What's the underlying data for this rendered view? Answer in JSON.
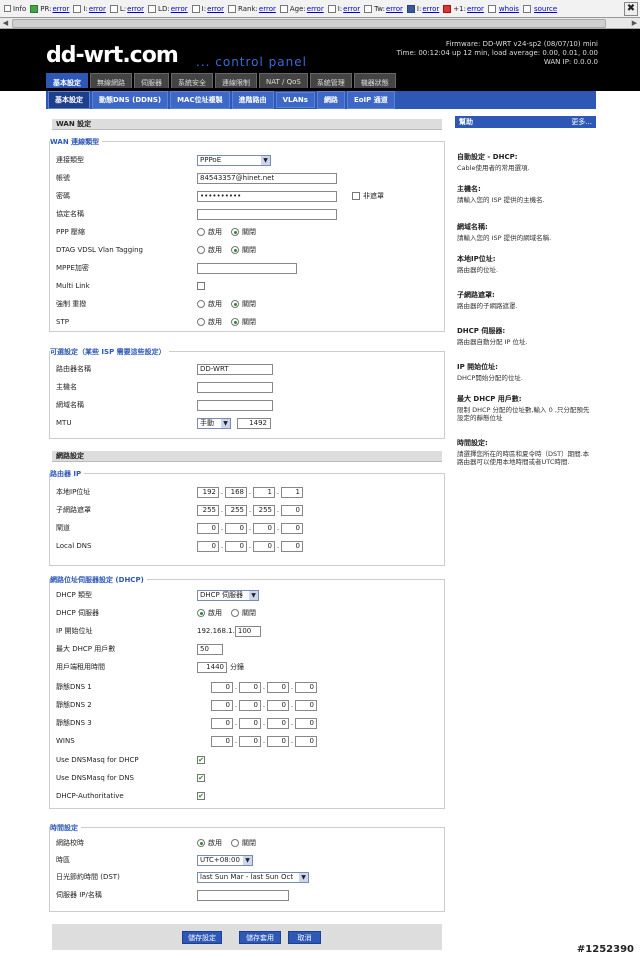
{
  "seobar": {
    "items": [
      {
        "label": "Info",
        "value": "",
        "icon": "info-icon"
      },
      {
        "label": "PR:",
        "value": "error",
        "icon": "google-icon"
      },
      {
        "label": "I:",
        "value": "error",
        "icon": "index-icon"
      },
      {
        "label": "L:",
        "value": "error",
        "icon": "link-icon"
      },
      {
        "label": "LD:",
        "value": "error",
        "icon": "linkdomain-icon"
      },
      {
        "label": "I:",
        "value": "error",
        "icon": "bing-icon"
      },
      {
        "label": "Rank:",
        "value": "error",
        "icon": "rank-icon"
      },
      {
        "label": "Age:",
        "value": "error",
        "icon": "age-icon"
      },
      {
        "label": "I:",
        "value": "error",
        "icon": "yahoo-icon"
      },
      {
        "label": "Tw:",
        "value": "error",
        "icon": "twitter-icon"
      },
      {
        "label": "I:",
        "value": "error",
        "icon": "facebook-icon"
      },
      {
        "label": "+1:",
        "value": "error",
        "icon": "gplus-icon"
      },
      {
        "label": "",
        "value": "whois",
        "icon": "whois-icon"
      },
      {
        "label": "",
        "value": "source",
        "icon": "source-icon"
      }
    ],
    "close": "✖"
  },
  "header": {
    "logo": "dd-wrt.com",
    "subtitle": "... control panel",
    "firmware": "Firmware: DD-WRT v24-sp2 (08/07/10) mini",
    "time": "Time: 00:12:04 up 12 min, load average: 0.00, 0.01, 0.00",
    "wanip": "WAN IP: 0.0.0.0"
  },
  "nav": {
    "main": [
      "基本設定",
      "無線網路",
      "伺服器",
      "系統安全",
      "連線限制",
      "NAT / QoS",
      "系統管理",
      "機器狀態"
    ],
    "sub": [
      "基本設定",
      "動態DNS (DDNS)",
      "MAC位址複製",
      "進階路由",
      "VLANs",
      "網路",
      "EoIP 通道"
    ]
  },
  "wan": {
    "section": "WAN 設定",
    "legend": "WAN 連線類型",
    "conn_type": {
      "label": "連接類型",
      "value": "PPPoE"
    },
    "username": {
      "label": "帳號",
      "value": "84543357@hinet.net"
    },
    "password": {
      "label": "密碼",
      "value": "••••••••••",
      "unmask": "非遮罩"
    },
    "service": {
      "label": "協定名稱"
    },
    "ppp_comp": {
      "label": "PPP 壓縮"
    },
    "dtag": {
      "label": "DTAG VDSL Vlan Tagging"
    },
    "mppe": {
      "label": "MPPE加密"
    },
    "multilink": {
      "label": "Multi Link"
    },
    "force": {
      "label": "強制 重撥"
    },
    "stp": {
      "label": "STP"
    },
    "enable": "啟用",
    "disable": "關閉"
  },
  "optional": {
    "legend": "可選設定（某些 ISP 需要這些設定）",
    "router_name": {
      "label": "路由器名稱",
      "value": "DD-WRT"
    },
    "hostname": {
      "label": "主機名"
    },
    "domain": {
      "label": "網域名稱"
    },
    "mtu": {
      "label": "MTU",
      "mode": "手動",
      "value": "1492"
    }
  },
  "network": {
    "section": "網路設定",
    "legend": "路由器 IP",
    "local_ip": {
      "label": "本地IP位址",
      "oct": [
        "192",
        "168",
        "1",
        "1"
      ]
    },
    "subnet": {
      "label": "子網路遮罩",
      "oct": [
        "255",
        "255",
        "255",
        "0"
      ]
    },
    "gateway": {
      "label": "閘道",
      "oct": [
        "0",
        "0",
        "0",
        "0"
      ]
    },
    "local_dns": {
      "label": "Local DNS",
      "oct": [
        "0",
        "0",
        "0",
        "0"
      ]
    }
  },
  "dhcp": {
    "legend": "網路位址伺服器設定 (DHCP)",
    "type": {
      "label": "DHCP 類型",
      "value": "DHCP 伺服器"
    },
    "server": {
      "label": "DHCP 伺服器"
    },
    "start_ip": {
      "label": "IP 開始位址",
      "prefix": "192.168.1.",
      "value": "100"
    },
    "max_users": {
      "label": "最大 DHCP 用戶數",
      "value": "50"
    },
    "lease": {
      "label": "用戶端租用時間",
      "value": "1440",
      "unit": "分鐘"
    },
    "dns1": {
      "label": "靜態DNS 1",
      "oct": [
        "0",
        "0",
        "0",
        "0"
      ]
    },
    "dns2": {
      "label": "靜態DNS 2",
      "oct": [
        "0",
        "0",
        "0",
        "0"
      ]
    },
    "dns3": {
      "label": "靜態DNS 3",
      "oct": [
        "0",
        "0",
        "0",
        "0"
      ]
    },
    "wins": {
      "label": "WINS",
      "oct": [
        "0",
        "0",
        "0",
        "0"
      ]
    },
    "dnsmasq_dhcp": {
      "label": "Use DNSMasq for DHCP"
    },
    "dnsmasq_dns": {
      "label": "Use DNSMasq for DNS"
    },
    "authoritative": {
      "label": "DHCP-Authoritative"
    }
  },
  "time": {
    "legend": "時間設定",
    "ntp": {
      "label": "網路校時"
    },
    "tz": {
      "label": "時區",
      "value": "UTC+08:00"
    },
    "dst": {
      "label": "日光節約時間 (DST)",
      "value": "last Sun Mar - last Sun Oct"
    },
    "server": {
      "label": "伺服器 IP/名稱"
    }
  },
  "buttons": {
    "save": "儲存設定",
    "apply": "儲存套用",
    "cancel": "取消"
  },
  "help": {
    "title": "幫助",
    "more": "更多...",
    "items": [
      {
        "t": "自動設定 - DHCP:",
        "d": "Cable使用者的常用選項."
      },
      {
        "t": "主機名:",
        "d": "請輸入您的 ISP 提供的主機名."
      },
      {
        "t": "網域名稱:",
        "d": "請輸入您的 ISP 提供的網域名稱."
      },
      {
        "t": "本地IP位址:",
        "d": "路由器的位址."
      },
      {
        "t": "子網路遮罩:",
        "d": "路由器的子網路遮罩."
      },
      {
        "t": "DHCP 伺服器:",
        "d": "路由器自動分配 IP 位址."
      },
      {
        "t": "IP 開始位址:",
        "d": "DHCP開始分配的位址."
      },
      {
        "t": "最大 DHCP 用戶數:",
        "d": "限制 DHCP 分配的位址數,輸入 0 ,只分配預先設定的靜態位址"
      },
      {
        "t": "時間設定:",
        "d": "請選擇您所在的時區和夏令時（DST）期間.本路由器可以使用本地時間或者UTC時間."
      }
    ]
  },
  "watermark": "#1252390"
}
